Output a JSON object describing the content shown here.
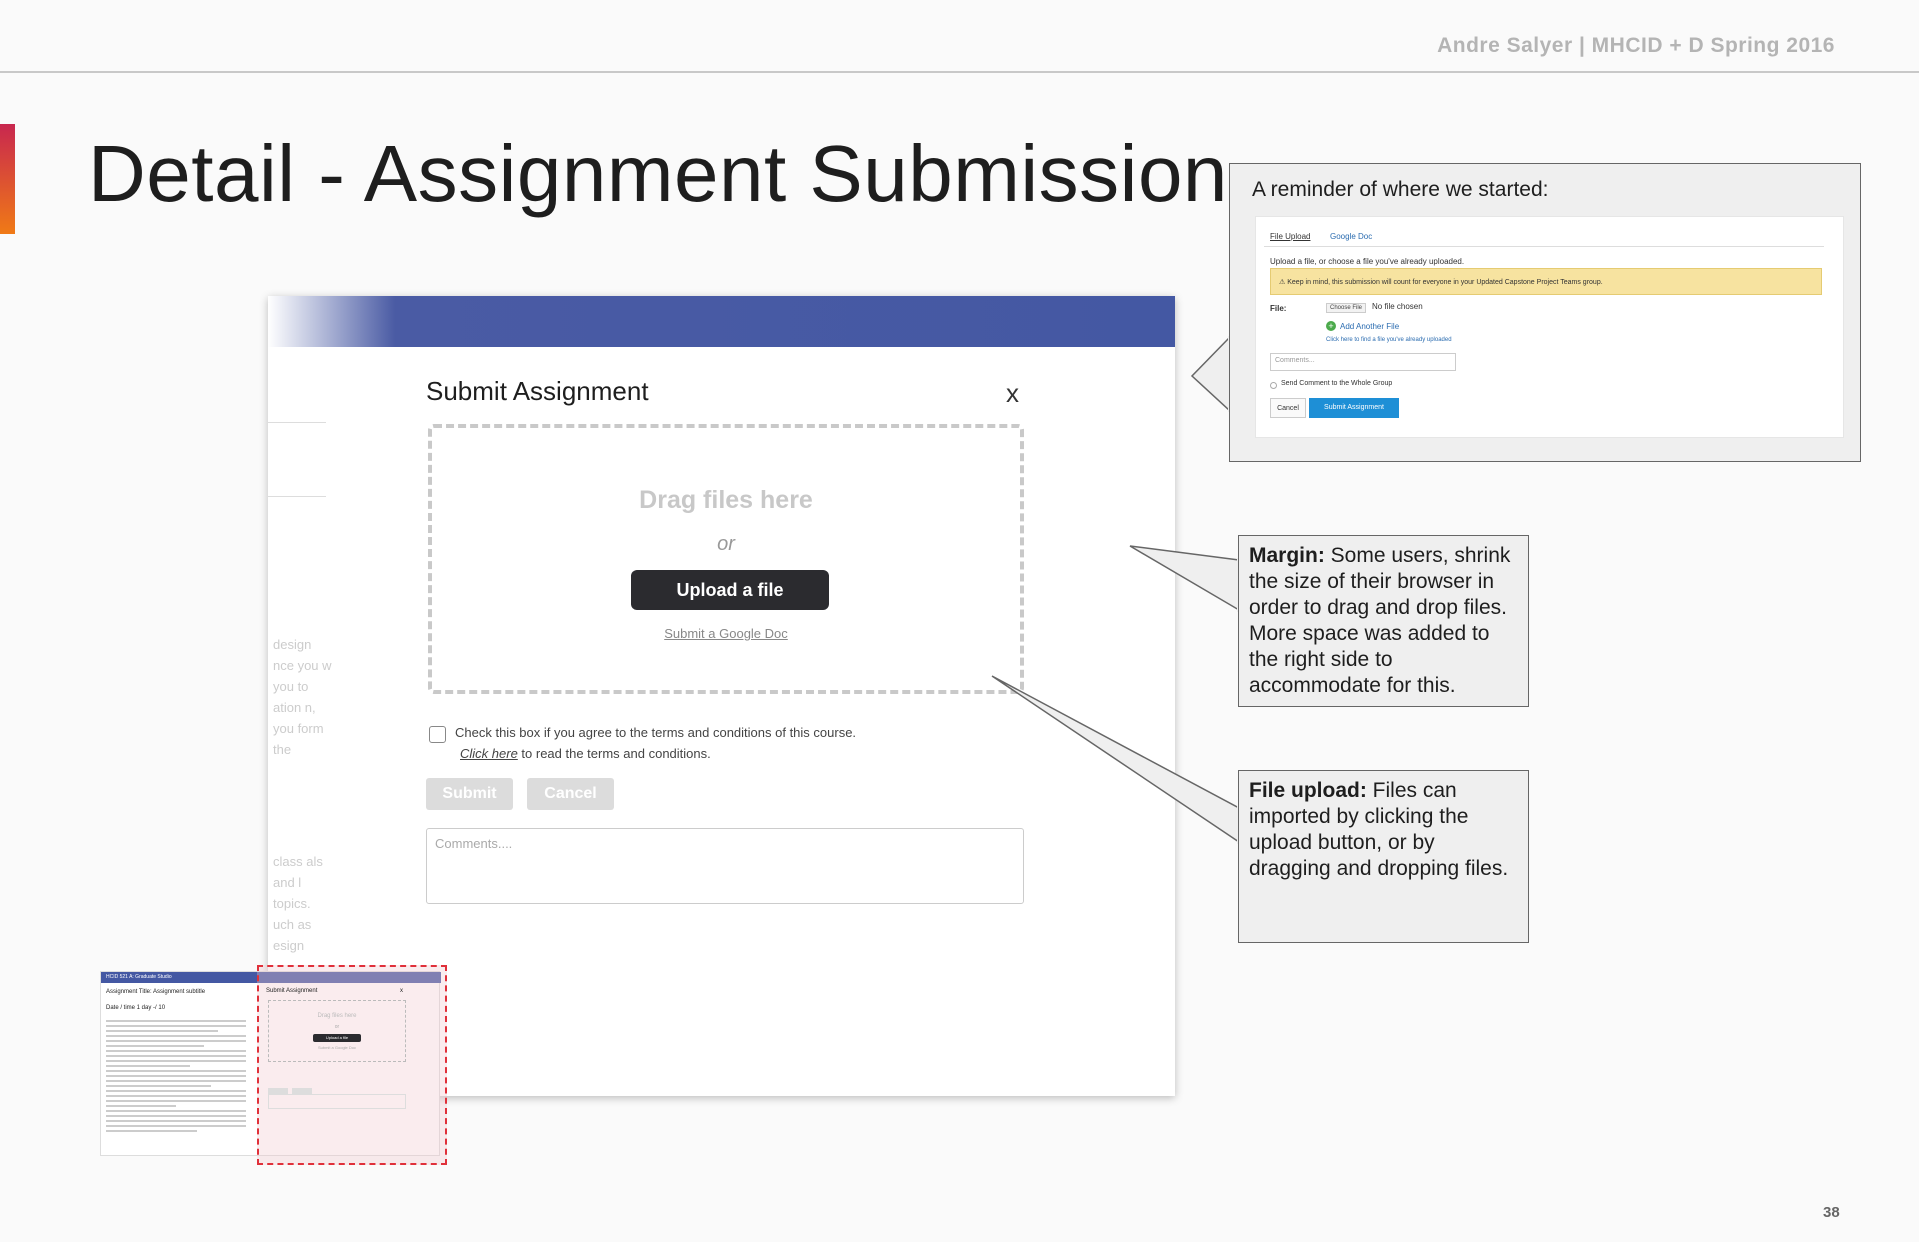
{
  "header": {
    "byline": "Andre Salyer | MHCID + D Spring 2016"
  },
  "slide": {
    "title": "Detail - Assignment Submission",
    "page_number": "38"
  },
  "modal": {
    "title": "Submit Assignment",
    "close": "x",
    "drag_text": "Drag files here",
    "or_text": "or",
    "upload_button": "Upload a file",
    "google_doc_link": "Submit a Google Doc",
    "agree_text": "Check this box if you agree to the terms and conditions of this course.",
    "terms_link": "Click here",
    "terms_rest": " to read the terms and conditions.",
    "submit_button": "Submit",
    "cancel_button": "Cancel",
    "comments_placeholder": "Comments...."
  },
  "background_text": {
    "block1": "design nce you w you to ation n, you form the",
    "block2": "class als and l topics. uch as esign"
  },
  "thumbnail": {
    "bar_text": "HCID 521 A: Graduate Studio",
    "left_title": "Assignment Title: Assignment subtitle",
    "left_date": "Date / time     1 day    -/ 10",
    "modal_title": "Submit Assignment",
    "close": "x",
    "drag": "Drag files here",
    "or": "or",
    "upload": "Upload a file",
    "gdoc": "Submit a Google Doc"
  },
  "reminder": {
    "label": "A reminder of where we started:",
    "tab_upload": "File Upload",
    "tab_google": "Google Doc",
    "instruction": "Upload a file, or choose a file you've already uploaded.",
    "warning": "Keep in mind, this submission will count for everyone in your Updated Capstone Project Teams group.",
    "file_label": "File:",
    "choose_file": "Choose File",
    "no_file": "No file chosen",
    "add_another": "Add Another File",
    "click_here": "Click here to find a file you've already uploaded",
    "comments_placeholder": "Comments...",
    "send_comment": "Send Comment to the Whole Group",
    "cancel": "Cancel",
    "submit": "Submit Assignment"
  },
  "notes": {
    "margin_bold": "Margin:",
    "margin_text": " Some users, shrink the size of their browser in order to drag and drop files. More space was added to the right side to accommodate for this.",
    "upload_bold": "File upload:",
    "upload_text": " Files can imported by clicking the upload button, or by dragging and dropping files."
  },
  "colors": {
    "accent_bar": "#4458a3",
    "highlight_border": "#e0303a",
    "upload_button": "#2b2b2f",
    "submit_assignment": "#1e8fd6"
  }
}
